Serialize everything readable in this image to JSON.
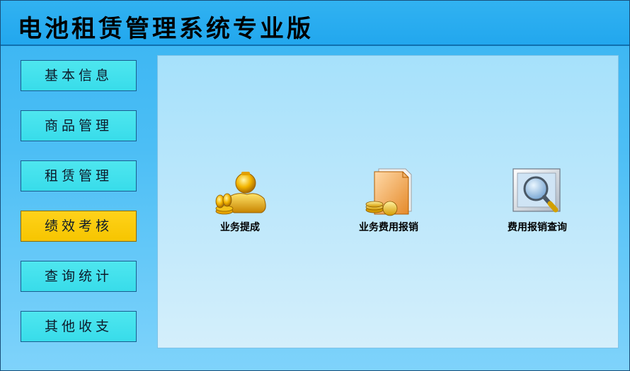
{
  "app": {
    "title": "电池租赁管理系统专业版"
  },
  "sidebar": {
    "items": [
      {
        "label": "基本信息",
        "active": false
      },
      {
        "label": "商品管理",
        "active": false
      },
      {
        "label": "租赁管理",
        "active": false
      },
      {
        "label": "绩效考核",
        "active": true
      },
      {
        "label": "查询统计",
        "active": false
      },
      {
        "label": "其他收支",
        "active": false
      }
    ]
  },
  "main": {
    "tiles": [
      {
        "label": "业务提成",
        "icon": "gold-money-icon"
      },
      {
        "label": "业务费用报销",
        "icon": "folder-coins-icon"
      },
      {
        "label": "费用报销查询",
        "icon": "magnifier-search-icon"
      }
    ]
  },
  "colors": {
    "title_bar": "#22a7ee",
    "background": "#4cbef5",
    "nav_button": "#40e0ec",
    "nav_button_active": "#f6c500",
    "content_panel": "#bfe8fb"
  }
}
